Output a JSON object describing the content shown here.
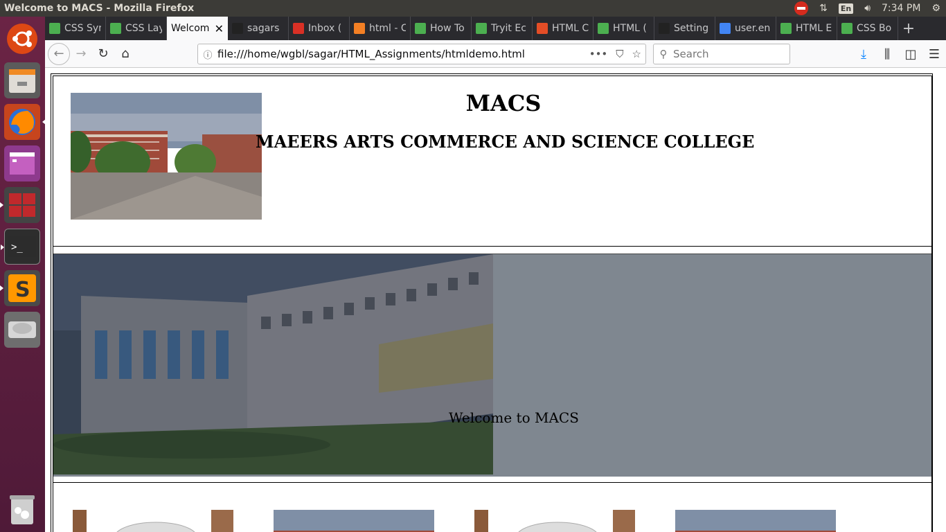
{
  "window": {
    "title": "Welcome to MACS - Mozilla Firefox"
  },
  "tray": {
    "lang": "En",
    "clock": "7:34 PM"
  },
  "tabs": [
    {
      "label": "CSS Syn",
      "fav": "w3",
      "color": "#4caf50"
    },
    {
      "label": "CSS Lay",
      "fav": "w3",
      "color": "#4caf50"
    },
    {
      "label": "Welcom",
      "fav": "",
      "color": "",
      "active": true
    },
    {
      "label": "sagars",
      "fav": "gh",
      "color": "#222"
    },
    {
      "label": "Inbox (",
      "fav": "M",
      "color": "#d93025"
    },
    {
      "label": "html - C",
      "fav": "so",
      "color": "#f48024"
    },
    {
      "label": "How To",
      "fav": "w3",
      "color": "#4caf50"
    },
    {
      "label": "Tryit Ec",
      "fav": "w3",
      "color": "#4caf50"
    },
    {
      "label": "HTML C",
      "fav": "c",
      "color": "#e44d26"
    },
    {
      "label": "HTML (",
      "fav": "w3",
      "color": "#4caf50"
    },
    {
      "label": "Setting",
      "fav": "gh",
      "color": "#222"
    },
    {
      "label": "user.en",
      "fav": "G",
      "color": "#4285f4"
    },
    {
      "label": "HTML E",
      "fav": "w3",
      "color": "#4caf50"
    },
    {
      "label": "CSS Bo",
      "fav": "w3",
      "color": "#4caf50"
    }
  ],
  "nav": {
    "url": "file:///home/wgbl/sagar/HTML_Assignments/htmldemo.html",
    "search_placeholder": "Search"
  },
  "content": {
    "title": "MACS",
    "subtitle": "MAEERS ARTS COMMERCE AND SCIENCE COLLEGE",
    "welcome": "Welcome to MACS"
  }
}
